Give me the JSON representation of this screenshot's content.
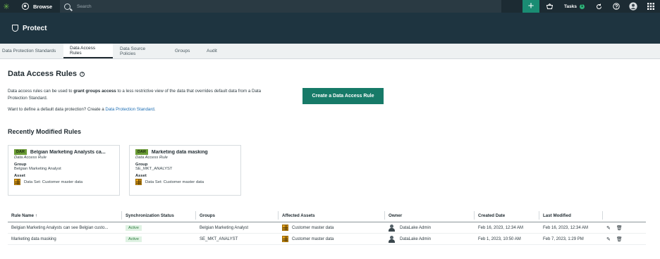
{
  "topbar": {
    "browse_label": "Browse",
    "search_placeholder": "Search",
    "add_symbol": "+",
    "tasks_label": "Tasks",
    "tasks_count": "1"
  },
  "appbar": {
    "title": "Protect"
  },
  "tabs": [
    {
      "label": "Data Protection Standards",
      "active": false
    },
    {
      "label": "Data Access Rules",
      "active": true
    },
    {
      "label": "Data Source Policies",
      "active": false
    },
    {
      "label": "Groups",
      "active": false
    },
    {
      "label": "Audit",
      "active": false
    }
  ],
  "page": {
    "title": "Data Access Rules",
    "help": "?",
    "desc_part1": "Data access rules can be used to ",
    "desc_bold": "grant groups access",
    "desc_part2": " to a less restrictive view of the data that overrides default data from a Data Protection Standard.",
    "desc2_text": "Want to define a default data protection? Create a ",
    "desc2_link": "Data Protection Standard",
    "desc2_end": ".",
    "cta": "Create a Data Access Rule"
  },
  "recent": {
    "title": "Recently Modified Rules",
    "cards": [
      {
        "tag": "DAR",
        "name": "Belgian Marketing Analysts ca...",
        "kind": "Data Access Rule",
        "group_label": "Group",
        "group": "Belgian Marketing Analyst",
        "asset_label": "Asset",
        "asset": "Data Set: Customer master data"
      },
      {
        "tag": "DAR",
        "name": "Marketing data masking",
        "kind": "Data Access Rule",
        "group_label": "Group",
        "group": "SE_MKT_ANALYST",
        "asset_label": "Asset",
        "asset": "Data Set: Customer master data"
      }
    ]
  },
  "table": {
    "headers": [
      "Rule Name",
      "Synchronization Status",
      "Groups",
      "Affected Assets",
      "Owner",
      "Created Date",
      "Last Modified"
    ],
    "sort_indicator": "↑",
    "rows": [
      {
        "name": "Belgian Marketing Analysts can see Belgian custo...",
        "status": "Active",
        "group": "Belgian Marketing Analyst",
        "asset": "Customer master data",
        "owner": "DataLake Admin",
        "created": "Feb 16, 2023, 12:34 AM",
        "modified": "Feb 16, 2023, 12:34 AM"
      },
      {
        "name": "Marketing data masking",
        "status": "Active",
        "group": "SE_MKT_ANALYST",
        "asset": "Customer master data",
        "owner": "DataLake Admin",
        "created": "Feb 1, 2023, 10:50 AM",
        "modified": "Feb 7, 2023, 1:29 PM"
      }
    ]
  }
}
